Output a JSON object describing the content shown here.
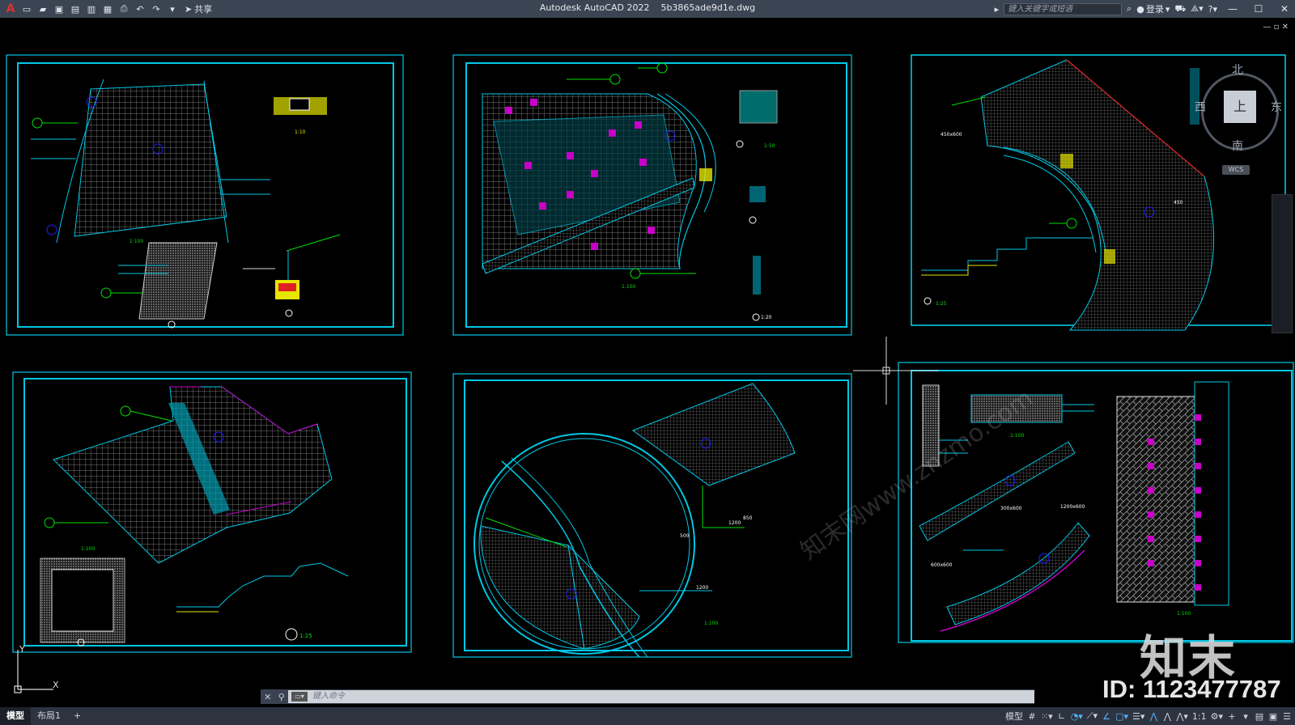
{
  "app": {
    "title": "Autodesk AutoCAD 2022",
    "filename": "5b3865ade9d1e.dwg",
    "logo_letter": "A"
  },
  "toolbar": {
    "share_label": "共享",
    "quick_access_icons": [
      "new-icon",
      "open-icon",
      "save-icon",
      "saveas-icon",
      "open-web-icon",
      "save-web-icon",
      "plot-icon",
      "undo-icon",
      "redo-icon",
      "dropdown-icon"
    ]
  },
  "search": {
    "placeholder": "键入关键字或短语"
  },
  "user": {
    "login_label": "登录"
  },
  "viewcube": {
    "north": "北",
    "south": "南",
    "east": "东",
    "west": "西",
    "face": "上",
    "wcs": "WCS"
  },
  "command": {
    "placeholder": "键入命令"
  },
  "layout_tabs": [
    {
      "label": "模型",
      "active": true
    },
    {
      "label": "布局1",
      "active": false
    },
    {
      "label": "+",
      "active": false
    }
  ],
  "status": {
    "model_label": "模型",
    "scale_label": "1:1"
  },
  "watermark": {
    "logo_text": "知末",
    "id_text": "ID: 1123477787",
    "site_text": "知末网www.znzmo.com"
  },
  "drawing_labels": {
    "scale_100": "1:100",
    "scale_25": "1:25",
    "scale_20": "1:20",
    "scale_10": "1:10",
    "scale_50": "1:50",
    "dim_1200": "1200",
    "dim_500": "500",
    "dim_850": "850",
    "dim_450": "450",
    "dim_1200x600": "1200x600",
    "dim_300x600": "300x600",
    "dim_600x600": "600x600",
    "dim_450x600": "450x600"
  },
  "colors": {
    "frame": "#00c8e6",
    "hatch": "#b4b4b4",
    "leader": "#00e000",
    "accent_magenta": "#c800c8",
    "accent_yellow": "#e6e600",
    "blue_marker": "#2020ff",
    "red_line": "#e02020"
  }
}
